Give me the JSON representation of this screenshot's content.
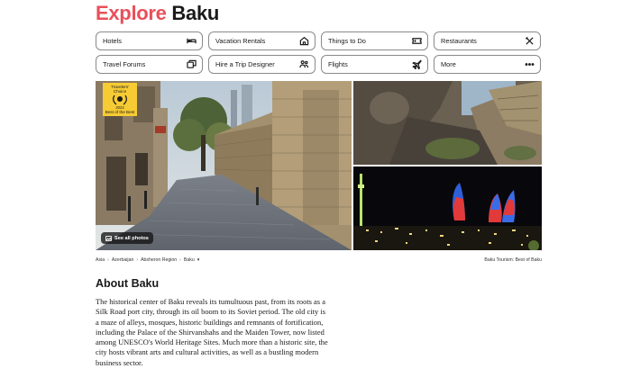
{
  "page": {
    "title_part1": "Explore",
    "title_part2": "Baku",
    "accent_color": "#e9505a"
  },
  "nav": {
    "buttons": [
      {
        "label": "Hotels",
        "icon": "bed-icon"
      },
      {
        "label": "Vacation Rentals",
        "icon": "house-icon"
      },
      {
        "label": "Things to Do",
        "icon": "ticket-icon"
      },
      {
        "label": "Restaurants",
        "icon": "fork-knife-icon"
      },
      {
        "label": "Travel Forums",
        "icon": "chat-bubbles-icon"
      },
      {
        "label": "Hire a Trip Designer",
        "icon": "people-icon"
      },
      {
        "label": "Flights",
        "icon": "airplane-icon"
      },
      {
        "label": "More",
        "icon": "more-dots-icon"
      }
    ]
  },
  "gallery": {
    "award": {
      "line1": "Travelers'",
      "line2": "Choice",
      "year": "2022",
      "subtitle": "Best of the Best"
    },
    "see_all_label": "See all photos"
  },
  "breadcrumb": {
    "items": [
      "Asia",
      "Azerbaijan",
      "Absheron Region",
      "Baku"
    ],
    "separator": "›",
    "right_text": "Baku Tourism: Best of Baku"
  },
  "about": {
    "heading": "About Baku",
    "text": "The historical center of Baku reveals its tumultuous past, from its roots as a Silk Road port city, through its oil boom to its Soviet period. The old city is a maze of alleys, mosques, historic buildings and remnants of fortification, including the Palace of the Shirvanshahs and the Maiden Tower, now listed among UNESCO's World Heritage Sites. Much more than a historic site, the city hosts vibrant arts and cultural activities, as well as a bustling modern business sector."
  }
}
